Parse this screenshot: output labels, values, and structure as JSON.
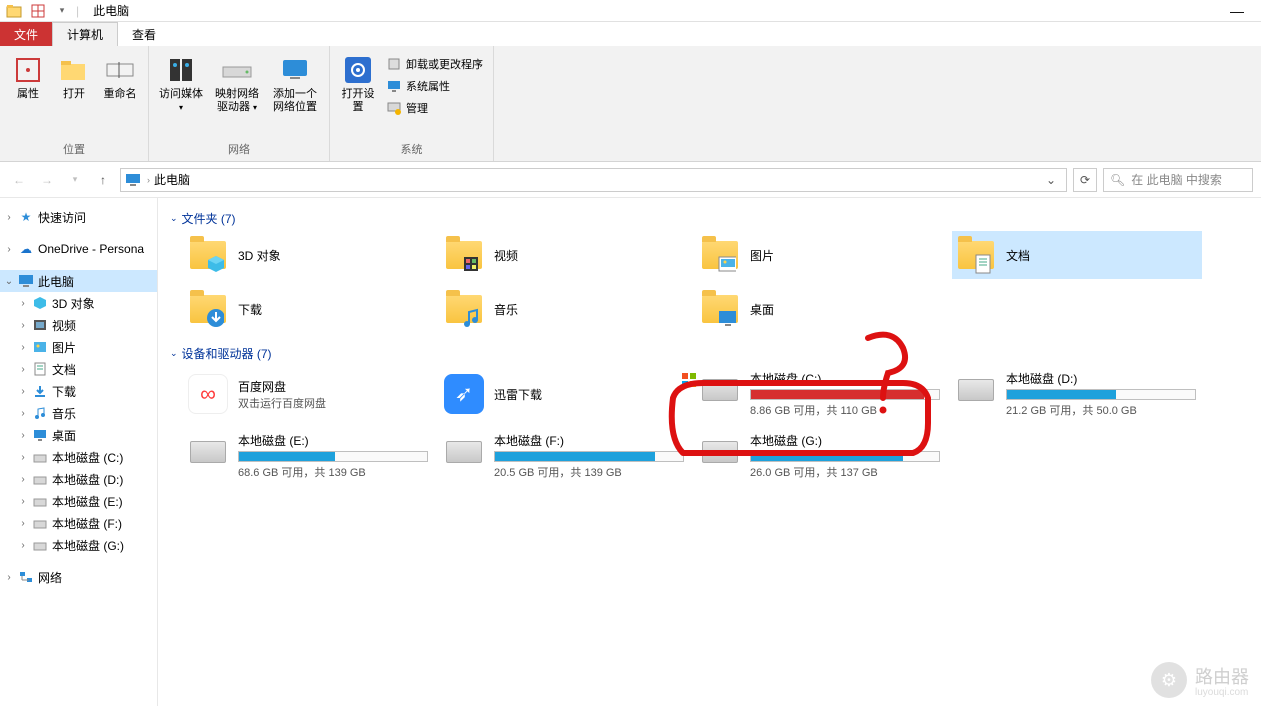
{
  "title": "此电脑",
  "tabs": {
    "file": "文件",
    "computer": "计算机",
    "view": "查看"
  },
  "ribbon": {
    "groups": {
      "location": {
        "label": "位置",
        "properties": "属性",
        "open": "打开",
        "rename": "重命名"
      },
      "network": {
        "label": "网络",
        "access_media": "访问媒体",
        "map_drive": "映射网络驱动器",
        "add_loc": "添加一个网络位置"
      },
      "system": {
        "label": "系统",
        "open_settings": "打开设置",
        "uninstall": "卸载或更改程序",
        "sys_props": "系统属性",
        "manage": "管理"
      }
    }
  },
  "breadcrumb": {
    "root": "此电脑"
  },
  "search_placeholder": "在 此电脑 中搜索",
  "tree": {
    "quick": "快速访问",
    "onedrive": "OneDrive - Persona",
    "thispc": "此电脑",
    "children": [
      {
        "label": "3D 对象"
      },
      {
        "label": "视频"
      },
      {
        "label": "图片"
      },
      {
        "label": "文档"
      },
      {
        "label": "下载"
      },
      {
        "label": "音乐"
      },
      {
        "label": "桌面"
      },
      {
        "label": "本地磁盘 (C:)"
      },
      {
        "label": "本地磁盘 (D:)"
      },
      {
        "label": "本地磁盘 (E:)"
      },
      {
        "label": "本地磁盘 (F:)"
      },
      {
        "label": "本地磁盘 (G:)"
      }
    ],
    "network": "网络"
  },
  "sections": {
    "folders": {
      "title": "文件夹 (7)",
      "items": [
        {
          "label": "3D 对象",
          "overlay": "cube"
        },
        {
          "label": "视频",
          "overlay": "film"
        },
        {
          "label": "图片",
          "overlay": "pic"
        },
        {
          "label": "文档",
          "overlay": "doc",
          "selected": true
        },
        {
          "label": "下载",
          "overlay": "down"
        },
        {
          "label": "音乐",
          "overlay": "note"
        },
        {
          "label": "桌面",
          "overlay": "desk"
        }
      ]
    },
    "devices": {
      "title": "设备和驱动器 (7)",
      "apps": [
        {
          "label": "百度网盘",
          "sub": "双击运行百度网盘",
          "bg": "#fff",
          "fg": "#ff3b3b",
          "glyph": "∞"
        },
        {
          "label": "迅雷下载",
          "bg": "#2f8cff",
          "fg": "#fff",
          "glyph": "➶"
        }
      ],
      "drives": [
        {
          "name": "本地磁盘 (C:)",
          "used_label": "8.86 GB 可用，共 110 GB",
          "fill_pct": 92,
          "color": "#d62f2f",
          "os": true
        },
        {
          "name": "本地磁盘 (D:)",
          "used_label": "21.2 GB 可用，共 50.0 GB",
          "fill_pct": 58,
          "color": "#1ea1dc"
        },
        {
          "name": "本地磁盘 (E:)",
          "used_label": "68.6 GB 可用，共 139 GB",
          "fill_pct": 51,
          "color": "#1ea1dc"
        },
        {
          "name": "本地磁盘 (F:)",
          "used_label": "20.5 GB 可用，共 139 GB",
          "fill_pct": 85,
          "color": "#1ea1dc"
        },
        {
          "name": "本地磁盘 (G:)",
          "used_label": "26.0 GB 可用，共 137 GB",
          "fill_pct": 81,
          "color": "#1ea1dc"
        }
      ]
    }
  },
  "watermark": {
    "brand": "路由器",
    "sub": "luyouqi.com"
  }
}
